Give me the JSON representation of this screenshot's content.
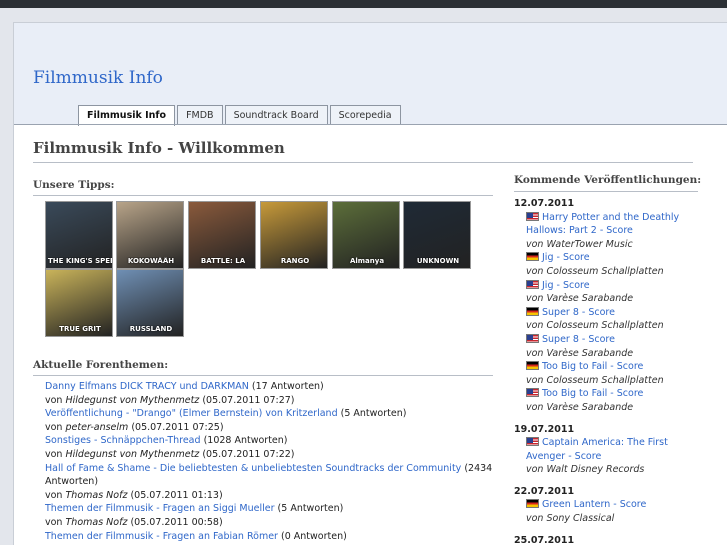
{
  "site": {
    "title": "Filmmusik Info"
  },
  "nav": {
    "tabs": [
      {
        "label": "Filmmusik Info",
        "active": true
      },
      {
        "label": "FMDB",
        "active": false
      },
      {
        "label": "Soundtrack Board",
        "active": false
      },
      {
        "label": "Scorepedia",
        "active": false
      }
    ]
  },
  "main": {
    "title": "Filmmusik Info - Willkommen",
    "tips_heading": "Unsere Tipps:",
    "tips": [
      {
        "caption": "THE KING'S SPEECH",
        "color": "#3a4a5a"
      },
      {
        "caption": "KOKOWÄÄH",
        "color": "#b8a489"
      },
      {
        "caption": "BATTLE: LA",
        "color": "#8a5a3c"
      },
      {
        "caption": "RANGO",
        "color": "#c79a3a"
      },
      {
        "caption": "Almanya",
        "color": "#5c6e3a"
      },
      {
        "caption": "UNKNOWN",
        "color": "#1f2a36"
      },
      {
        "caption": "TRUE GRIT",
        "color": "#c9b35a"
      },
      {
        "caption": "RUSSLAND",
        "color": "#6f8fb4"
      }
    ],
    "forum_heading": "Aktuelle Forenthemen:",
    "forum_by_prefix": "von",
    "forum": [
      {
        "topic": "Danny Elfmans DICK TRACY und DARKMAN",
        "count": "(17 Antworten)",
        "user": "Hildegunst von Mythenmetz",
        "time": "(05.07.2011 07:27)"
      },
      {
        "topic": "Veröffentlichung - \"Drango\" (Elmer Bernstein) von Kritzerland",
        "count": "(5 Antworten)",
        "user": "peter-anselm",
        "time": "(05.07.2011 07:25)"
      },
      {
        "topic": "Sonstiges - Schnäppchen-Thread",
        "count": "(1028 Antworten)",
        "user": "Hildegunst von Mythenmetz",
        "time": "(05.07.2011 07:22)"
      },
      {
        "topic": "Hall of Fame & Shame - Die beliebtesten & unbeliebtesten Soundtracks der Community",
        "count": "(2434 Antworten)",
        "user": "Thomas Nofz",
        "time": "(05.07.2011 01:13)"
      },
      {
        "topic": "Themen der Filmmusik - Fragen an Siggi Mueller",
        "count": "(5 Antworten)",
        "user": "Thomas Nofz",
        "time": "(05.07.2011 00:58)"
      },
      {
        "topic": "Themen der Filmmusik - Fragen an Fabian Römer",
        "count": "(0 Antworten)",
        "user": "",
        "time": ""
      }
    ]
  },
  "sidebar": {
    "heading": "Kommende Veröffentlichungen:",
    "label_prefix": "von",
    "groups": [
      {
        "date": "12.07.2011",
        "items": [
          {
            "flag": "us",
            "title": "Harry Potter and the Deathly Hallows: Part 2 - Score",
            "label": "WaterTower Music"
          },
          {
            "flag": "de",
            "title": "Jig - Score",
            "label": "Colosseum Schallplatten"
          },
          {
            "flag": "us",
            "title": "Jig - Score",
            "label": "Varèse Sarabande"
          },
          {
            "flag": "de",
            "title": "Super 8 - Score",
            "label": "Colosseum Schallplatten"
          },
          {
            "flag": "us",
            "title": "Super 8 - Score",
            "label": "Varèse Sarabande"
          },
          {
            "flag": "de",
            "title": "Too Big to Fail - Score",
            "label": "Colosseum Schallplatten"
          },
          {
            "flag": "us",
            "title": "Too Big to Fail - Score",
            "label": "Varèse Sarabande"
          }
        ]
      },
      {
        "date": "19.07.2011",
        "items": [
          {
            "flag": "us",
            "title": "Captain America: The First Avenger - Score",
            "label": "Walt Disney Records"
          }
        ]
      },
      {
        "date": "22.07.2011",
        "items": [
          {
            "flag": "de",
            "title": "Green Lantern - Score",
            "label": "Sony Classical"
          }
        ]
      },
      {
        "date": "25.07.2011",
        "items": []
      }
    ]
  }
}
